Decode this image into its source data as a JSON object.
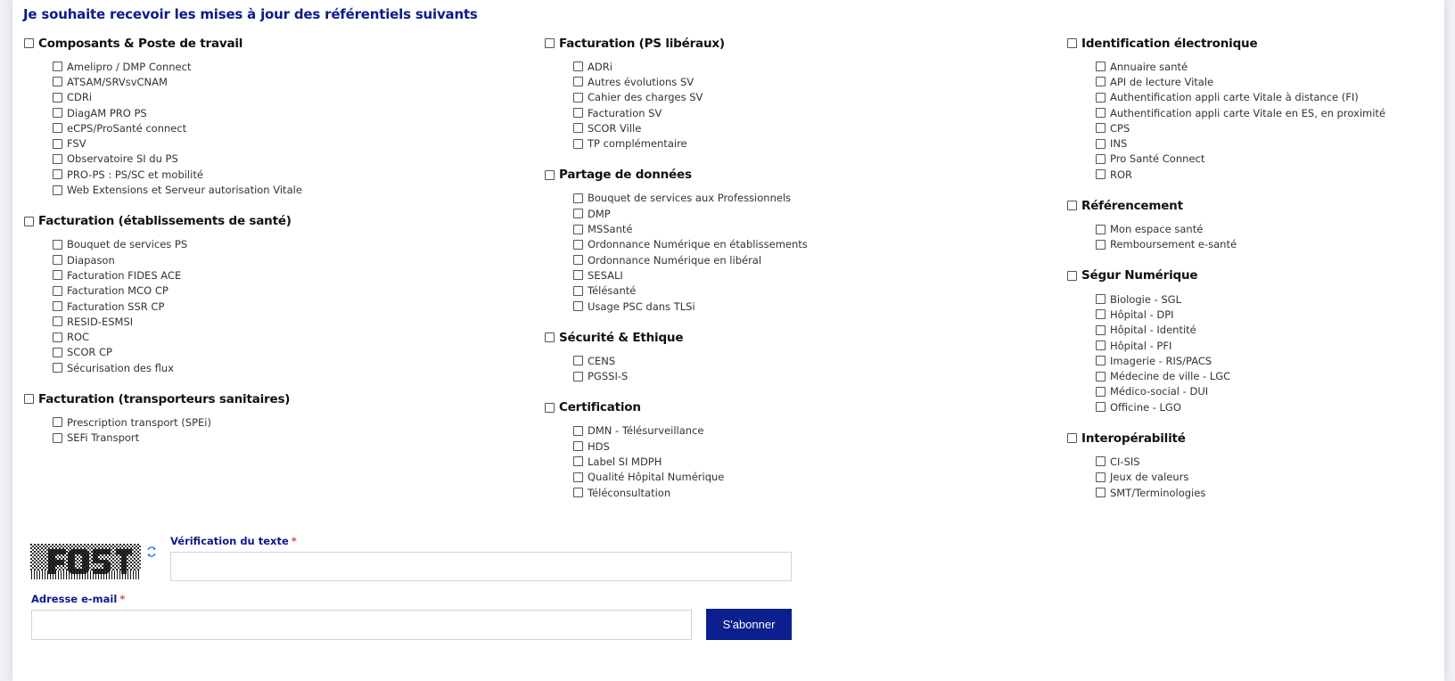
{
  "title": "Je souhaite recevoir les mises à jour des référentiels suivants",
  "columns": [
    [
      {
        "label": "Composants & Poste de travail",
        "items": [
          "Amelipro / DMP Connect",
          "ATSAM/SRVsvCNAM",
          "CDRi",
          "DiagAM PRO PS",
          "eCPS/ProSanté connect",
          "FSV",
          "Observatoire SI du PS",
          "PRO-PS : PS/SC et mobilité",
          "Web Extensions et Serveur autorisation Vitale"
        ]
      },
      {
        "label": "Facturation (établissements de santé)",
        "items": [
          "Bouquet de services PS",
          "Diapason",
          "Facturation FIDES ACE",
          "Facturation MCO CP",
          "Facturation SSR CP",
          "RESID-ESMSI",
          "ROC",
          "SCOR CP",
          "Sécurisation des flux"
        ]
      },
      {
        "label": "Facturation (transporteurs sanitaires)",
        "items": [
          "Prescription transport (SPEi)",
          "SEFi Transport"
        ]
      }
    ],
    [
      {
        "label": "Facturation (PS libéraux)",
        "items": [
          "ADRi",
          "Autres évolutions SV",
          "Cahier des charges SV",
          "Facturation SV",
          "SCOR Ville",
          "TP complémentaire"
        ]
      },
      {
        "label": "Partage de données",
        "items": [
          "Bouquet de services aux Professionnels",
          "DMP",
          "MSSanté",
          "Ordonnance Numérique en établissements",
          "Ordonnance Numérique en libéral",
          "SESALI",
          "Télésanté",
          "Usage PSC dans TLSi"
        ]
      },
      {
        "label": "Sécurité & Ethique",
        "items": [
          "CENS",
          "PGSSI-S"
        ]
      },
      {
        "label": "Certification",
        "items": [
          "DMN - Télésurveillance",
          "HDS",
          "Label SI MDPH",
          "Qualité Hôpital Numérique",
          "Téléconsultation"
        ]
      }
    ],
    [
      {
        "label": "Identification électronique",
        "items": [
          "Annuaire santé",
          "API de lecture Vitale",
          "Authentification appli carte Vitale à distance (FI)",
          "Authentification appli carte Vitale en ES, en proximité",
          "CPS",
          "INS",
          "Pro Santé Connect",
          "ROR"
        ]
      },
      {
        "label": "Référencement",
        "items": [
          "Mon espace santé",
          "Remboursement e-santé"
        ]
      },
      {
        "label": "Ségur Numérique",
        "items": [
          "Biologie - SGL",
          "Hôpital - DPI",
          "Hôpital - Identité",
          "Hôpital - PFI",
          "Imagerie - RIS/PACS",
          "Médecine de ville - LGC",
          "Médico-social - DUI",
          "Officine - LGO"
        ]
      },
      {
        "label": "Interopérabilité",
        "items": [
          "CI-SIS",
          "Jeux de valeurs",
          "SMT/Terminologies"
        ]
      }
    ]
  ],
  "form": {
    "captcha_label": "Vérification du texte",
    "email_label": "Adresse e-mail",
    "required_mark": "*",
    "captcha_value": "",
    "email_value": "",
    "subscribe_label": "S'abonner"
  }
}
